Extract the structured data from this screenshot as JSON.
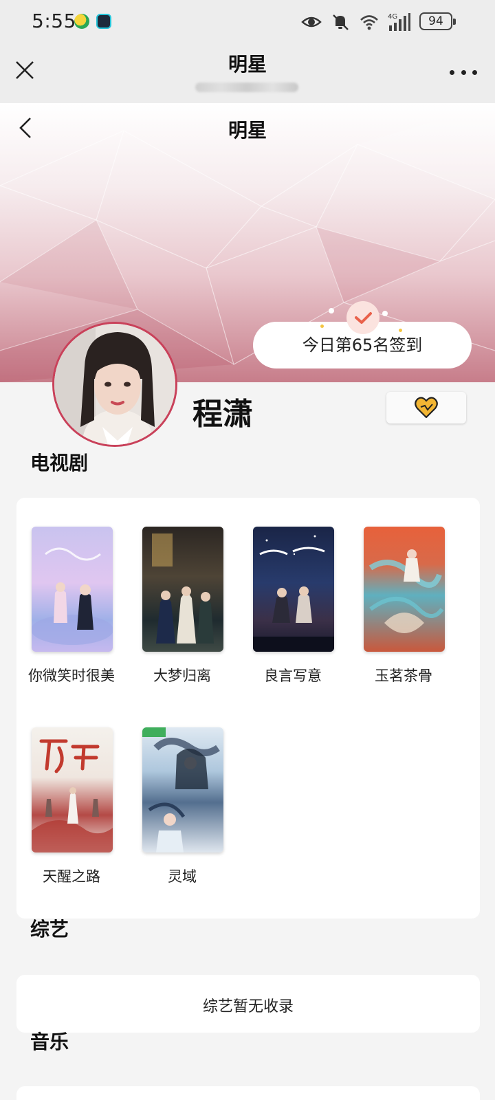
{
  "status_bar": {
    "time": "5:55",
    "battery": "94",
    "network": "4G",
    "icons": [
      "eye-icon",
      "bell-muted-icon",
      "wifi-icon",
      "signal-icon"
    ]
  },
  "app_bar": {
    "title": "明星",
    "close_icon": "close-icon",
    "more_icon": "more-icon"
  },
  "banner": {
    "title": "明星",
    "back_icon": "back-icon",
    "checkin_text": "今日第65名签到",
    "colors": {
      "accent": "#c9415a",
      "checkin_badge": "#e9614b",
      "heart": "#f2b533"
    }
  },
  "profile": {
    "name": "程潇",
    "follow_icon": "heart-icon"
  },
  "tv_section": {
    "title": "电视剧",
    "items": [
      {
        "title": "你微笑时很美"
      },
      {
        "title": "大梦归离"
      },
      {
        "title": "良言写意"
      },
      {
        "title": "玉茗茶骨"
      },
      {
        "title": "天醒之路"
      },
      {
        "title": "灵域"
      }
    ]
  },
  "variety_section": {
    "title": "综艺",
    "empty_text": "综艺暂无收录"
  },
  "music_section": {
    "title": "音乐"
  }
}
